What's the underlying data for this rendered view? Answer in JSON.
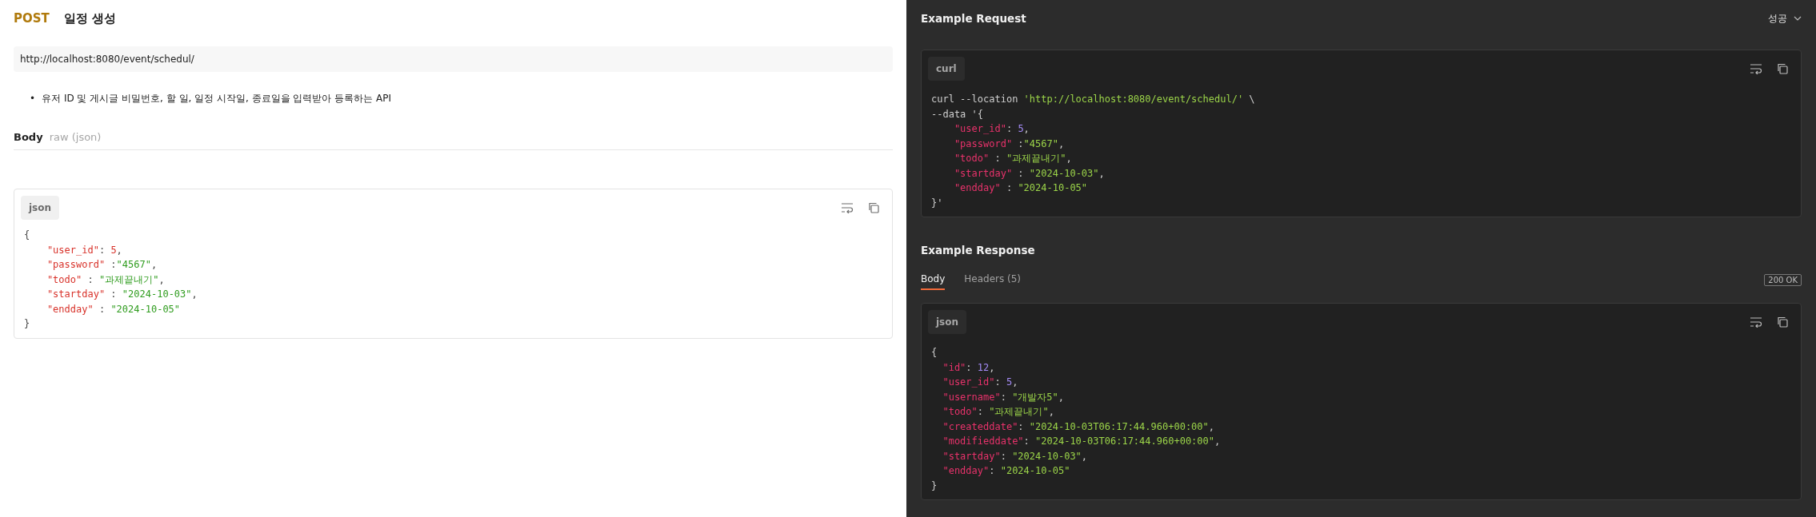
{
  "request": {
    "method": "POST",
    "name": "일정 생성",
    "url": "http://localhost:8080/event/schedul/",
    "description": [
      {
        "bullet": "•",
        "text": "유저 ID 및 게시글 비밀번호, 할 일, 일정 시작일, 종료일을 입력받아 등록하는 API"
      }
    ],
    "body_label": "Body",
    "body_type": "raw (json)",
    "body_code": {
      "language": "json",
      "lines": [
        {
          "indented": false,
          "tokens": [
            {
              "kind": "plain",
              "text": "{"
            }
          ]
        },
        {
          "indented": true,
          "tokens": [
            {
              "kind": "key",
              "text": "\"user_id\""
            },
            {
              "kind": "plain",
              "text": ": "
            },
            {
              "kind": "number",
              "text": "5"
            },
            {
              "kind": "plain",
              "text": ","
            }
          ]
        },
        {
          "indented": true,
          "tokens": [
            {
              "kind": "key",
              "text": "\"password\""
            },
            {
              "kind": "plain",
              "text": " :"
            },
            {
              "kind": "string",
              "text": "\"4567\""
            },
            {
              "kind": "plain",
              "text": ","
            }
          ]
        },
        {
          "indented": true,
          "tokens": [
            {
              "kind": "key",
              "text": "\"todo\""
            },
            {
              "kind": "plain",
              "text": " : "
            },
            {
              "kind": "string",
              "text": "\"과제끝내기\""
            },
            {
              "kind": "plain",
              "text": ","
            }
          ]
        },
        {
          "indented": true,
          "tokens": [
            {
              "kind": "key",
              "text": "\"startday\""
            },
            {
              "kind": "plain",
              "text": " : "
            },
            {
              "kind": "string",
              "text": "\"2024-10-03\""
            },
            {
              "kind": "plain",
              "text": ","
            }
          ]
        },
        {
          "indented": true,
          "tokens": [
            {
              "kind": "key",
              "text": "\"endday\""
            },
            {
              "kind": "plain",
              "text": " : "
            },
            {
              "kind": "string",
              "text": "\"2024-10-05\""
            }
          ]
        },
        {
          "indented": false,
          "tokens": [
            {
              "kind": "plain",
              "text": "}"
            }
          ]
        }
      ]
    }
  },
  "example_request": {
    "title": "Example Request",
    "example_select": "성공",
    "code": {
      "language": "curl",
      "lines": [
        {
          "indented": false,
          "tokens": [
            {
              "kind": "plain",
              "text": "curl --location "
            },
            {
              "kind": "string",
              "text": "'http://localhost:8080/event/schedul/'"
            },
            {
              "kind": "plain",
              "text": " \\"
            }
          ]
        },
        {
          "indented": false,
          "tokens": [
            {
              "kind": "plain",
              "text": "--data '{"
            }
          ]
        },
        {
          "indented": true,
          "tokens": [
            {
              "kind": "key",
              "text": "\"user_id\""
            },
            {
              "kind": "plain",
              "text": ": "
            },
            {
              "kind": "number",
              "text": "5"
            },
            {
              "kind": "plain",
              "text": ","
            }
          ]
        },
        {
          "indented": true,
          "tokens": [
            {
              "kind": "key",
              "text": "\"password\""
            },
            {
              "kind": "plain",
              "text": " :"
            },
            {
              "kind": "string",
              "text": "\"4567\""
            },
            {
              "kind": "plain",
              "text": ","
            }
          ]
        },
        {
          "indented": true,
          "tokens": [
            {
              "kind": "key",
              "text": "\"todo\""
            },
            {
              "kind": "plain",
              "text": " : "
            },
            {
              "kind": "string",
              "text": "\"과제끝내기\""
            },
            {
              "kind": "plain",
              "text": ","
            }
          ]
        },
        {
          "indented": true,
          "tokens": [
            {
              "kind": "key",
              "text": "\"startday\""
            },
            {
              "kind": "plain",
              "text": " : "
            },
            {
              "kind": "string",
              "text": "\"2024-10-03\""
            },
            {
              "kind": "plain",
              "text": ","
            }
          ]
        },
        {
          "indented": true,
          "tokens": [
            {
              "kind": "key",
              "text": "\"endday\""
            },
            {
              "kind": "plain",
              "text": " : "
            },
            {
              "kind": "string",
              "text": "\"2024-10-05\""
            }
          ]
        },
        {
          "indented": false,
          "tokens": [
            {
              "kind": "plain",
              "text": "}'"
            }
          ]
        }
      ]
    }
  },
  "example_response": {
    "title": "Example Response",
    "tabs": [
      {
        "label": "Body",
        "selected": true
      },
      {
        "label": "Headers (5)",
        "selected": false
      }
    ],
    "status": "200 OK",
    "code": {
      "language": "json",
      "lines": [
        {
          "indented": false,
          "tokens": [
            {
              "kind": "plain",
              "text": "{"
            }
          ]
        },
        {
          "indented": true,
          "tokens": [
            {
              "kind": "key",
              "text": "\"id\""
            },
            {
              "kind": "plain",
              "text": ": "
            },
            {
              "kind": "number",
              "text": "12"
            },
            {
              "kind": "plain",
              "text": ","
            }
          ]
        },
        {
          "indented": true,
          "tokens": [
            {
              "kind": "key",
              "text": "\"user_id\""
            },
            {
              "kind": "plain",
              "text": ": "
            },
            {
              "kind": "number",
              "text": "5"
            },
            {
              "kind": "plain",
              "text": ","
            }
          ]
        },
        {
          "indented": true,
          "tokens": [
            {
              "kind": "key",
              "text": "\"username\""
            },
            {
              "kind": "plain",
              "text": ": "
            },
            {
              "kind": "string",
              "text": "\"개발자5\""
            },
            {
              "kind": "plain",
              "text": ","
            }
          ]
        },
        {
          "indented": true,
          "tokens": [
            {
              "kind": "key",
              "text": "\"todo\""
            },
            {
              "kind": "plain",
              "text": ": "
            },
            {
              "kind": "string",
              "text": "\"과제끝내기\""
            },
            {
              "kind": "plain",
              "text": ","
            }
          ]
        },
        {
          "indented": true,
          "tokens": [
            {
              "kind": "key",
              "text": "\"createddate\""
            },
            {
              "kind": "plain",
              "text": ": "
            },
            {
              "kind": "string",
              "text": "\"2024-10-03T06:17:44.960+00:00\""
            },
            {
              "kind": "plain",
              "text": ","
            }
          ]
        },
        {
          "indented": true,
          "tokens": [
            {
              "kind": "key",
              "text": "\"modifieddate\""
            },
            {
              "kind": "plain",
              "text": ": "
            },
            {
              "kind": "string",
              "text": "\"2024-10-03T06:17:44.960+00:00\""
            },
            {
              "kind": "plain",
              "text": ","
            }
          ]
        },
        {
          "indented": true,
          "tokens": [
            {
              "kind": "key",
              "text": "\"startday\""
            },
            {
              "kind": "plain",
              "text": ": "
            },
            {
              "kind": "string",
              "text": "\"2024-10-03\""
            },
            {
              "kind": "plain",
              "text": ","
            }
          ]
        },
        {
          "indented": true,
          "tokens": [
            {
              "kind": "key",
              "text": "\"endday\""
            },
            {
              "kind": "plain",
              "text": ": "
            },
            {
              "kind": "string",
              "text": "\"2024-10-05\""
            }
          ]
        },
        {
          "indented": false,
          "tokens": [
            {
              "kind": "plain",
              "text": "}"
            }
          ]
        }
      ]
    }
  }
}
